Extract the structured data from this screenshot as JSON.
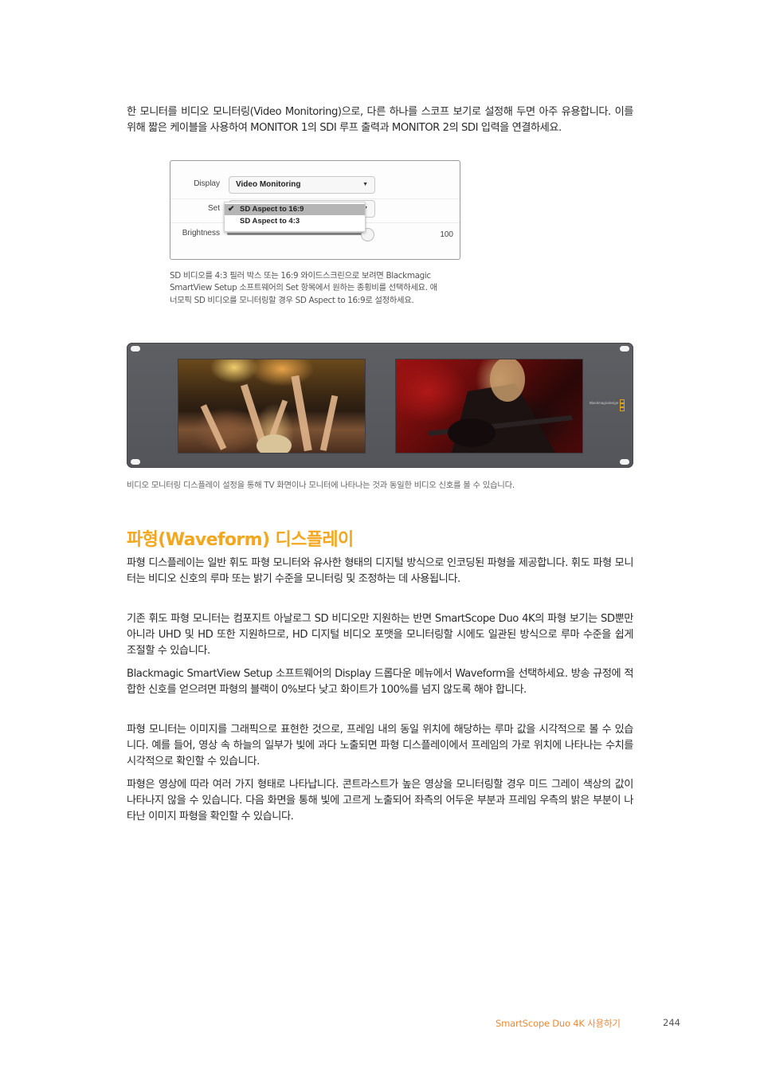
{
  "intro": {
    "text": "한 모니터를 비디오 모니터링(Video Monitoring)으로, 다른 하나를 스코프 보기로 설정해 두면 아주 유용합니다. 이를 위해 짧은 케이블을 사용하여 MONITOR 1의 SDI 루프 출력과 MONITOR 2의 SDI 입력을 연결하세요."
  },
  "settings_panel": {
    "display_label": "Display",
    "display_value": "Video Monitoring",
    "set_label": "Set",
    "set_options": [
      {
        "label": "SD Aspect to 16:9",
        "selected": true
      },
      {
        "label": "SD Aspect to 4:3",
        "selected": false
      }
    ],
    "brightness_label": "Brightness",
    "brightness_value": "100",
    "brightness_fraction": 1.0,
    "caret_icon": "▼",
    "check_icon": "✔"
  },
  "settings_caption": "SD 비디오를 4:3 필러 박스 또는 16:9 와이드스크린으로 보려면 Blackmagic SmartView Setup 소프트웨어의 Set 항목에서 원하는 종횡비를 선택하세요. 애너모픽 SD 비디오를 모니터링할 경우 SD Aspect to 16:9로 설정하세요.",
  "device": {
    "brand": "Blackmagicdesign",
    "left_screen": "concert-crowd-image",
    "right_screen": "guitarist-image"
  },
  "device_caption": "비디오 모니터링 디스플레이 설정을 통해 TV 화면이나 모니터에 나타나는 것과 동일한 비디오 신호를 볼 수 있습니다.",
  "section": {
    "heading": "파형(Waveform) 디스플레이",
    "paragraphs": [
      "파형 디스플레이는 일반 휘도 파형 모니터와 유사한 형태의 디지털 방식으로 인코딩된 파형을 제공합니다. 휘도 파형 모니터는 비디오 신호의 루마 또는 밝기 수준을 모니터링 및 조정하는 데 사용됩니다.",
      "기존 휘도 파형 모니터는 컴포지트 아날로그 SD 비디오만 지원하는 반면 SmartScope Duo 4K의 파형 보기는 SD뿐만 아니라 UHD 및 HD 또한 지원하므로, HD 디지털 비디오 포맷을 모니터링할 시에도 일관된 방식으로 루마 수준을 쉽게 조절할 수 있습니다.",
      "Blackmagic SmartView Setup 소프트웨어의 Display 드롭다운 메뉴에서 Waveform을 선택하세요. 방송 규정에 적합한 신호를 얻으려면 파형의 블랙이 0%보다 낮고 화이트가 100%를 넘지 않도록 해야 합니다.",
      "파형 모니터는 이미지를 그래픽으로 표현한 것으로, 프레임 내의 동일 위치에 해당하는 루마 값을 시각적으로 볼 수 있습니다. 예를 들어, 영상 속 하늘의 일부가 빛에 과다 노출되면 파형 디스플레이에서 프레임의 가로 위치에 나타나는 수치를 시각적으로 확인할 수 있습니다.",
      "파형은 영상에 따라 여러 가지 형태로 나타납니다. 콘트라스트가 높은 영상을 모니터링할 경우 미드 그레이 색상의 값이 나타나지 않을 수 있습니다. 다음 화면을 통해 빛에 고르게 노출되어 좌측의 어두운 부분과 프레임 우측의 밝은 부분이 나타난 이미지 파형을 확인할 수 있습니다."
    ]
  },
  "footer": {
    "title": "SmartScope Duo 4K 사용하기",
    "page": "244"
  },
  "colors": {
    "heading": "#f3a71f",
    "footer_title": "#e98a3a"
  }
}
